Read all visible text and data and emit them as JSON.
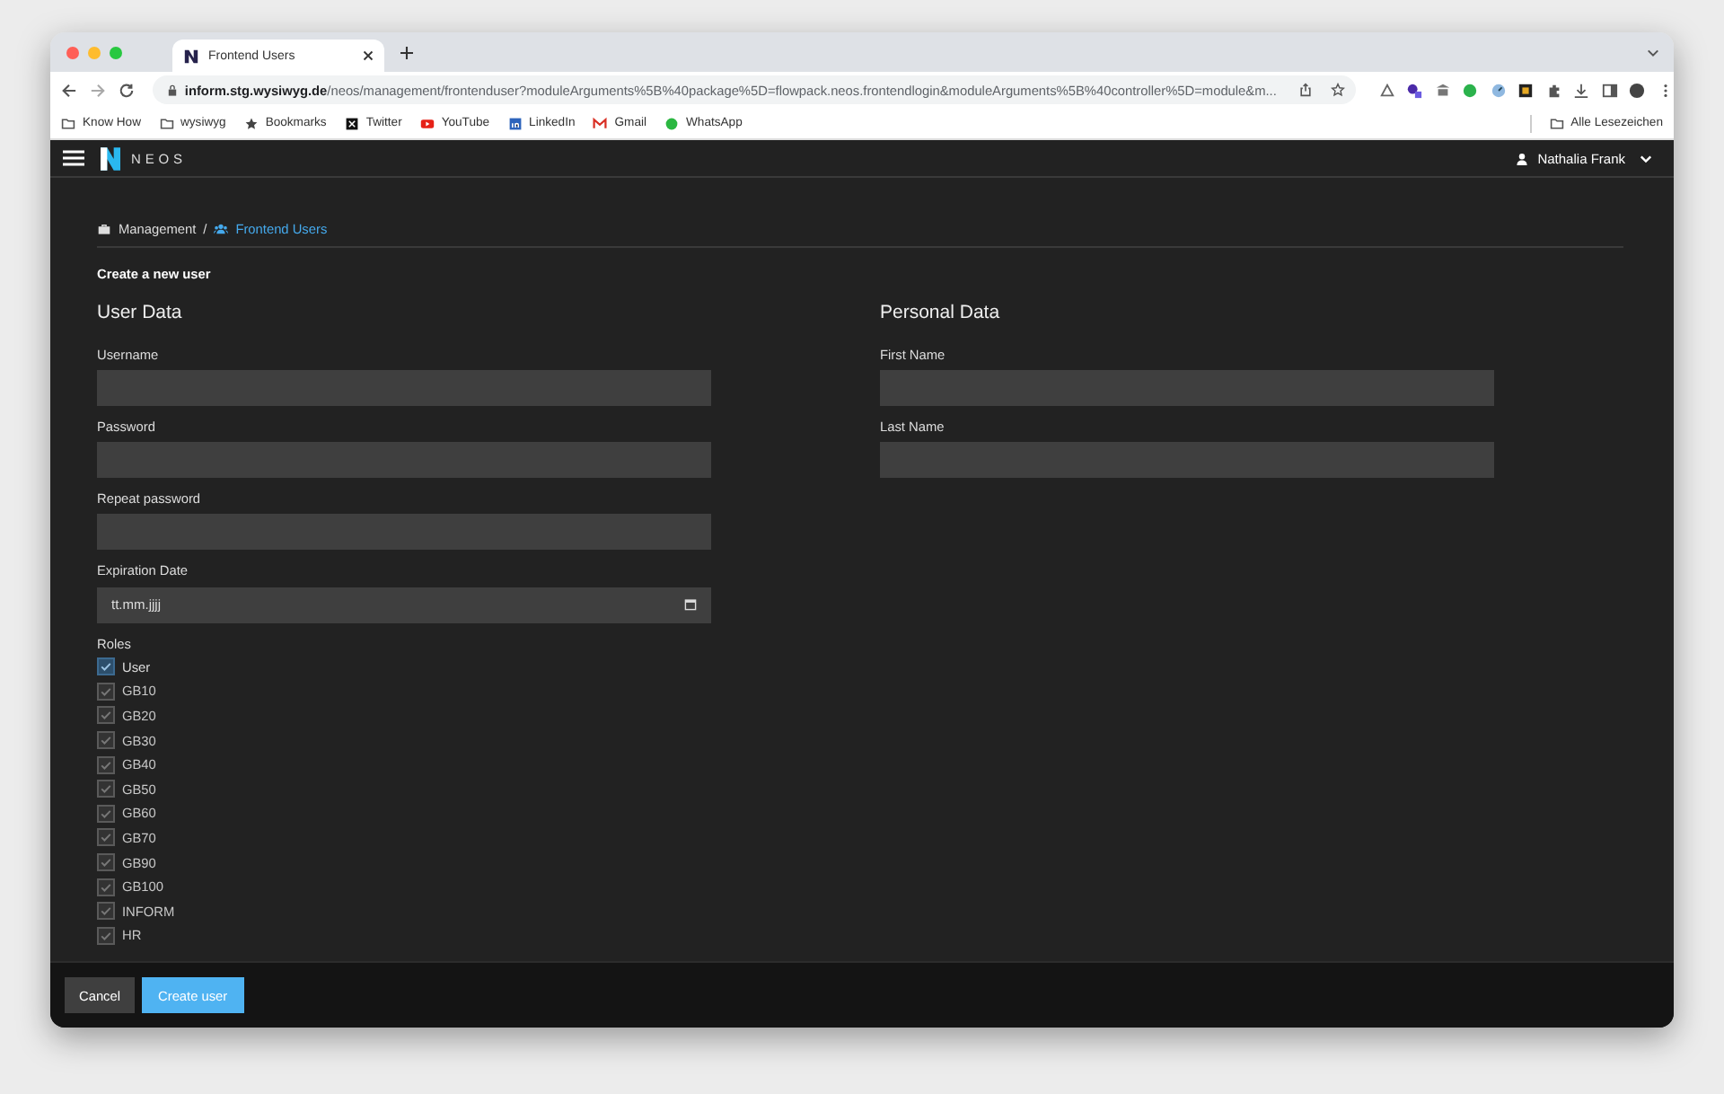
{
  "browser": {
    "tab_title": "Frontend Users",
    "url_host": "inform.stg.wysiwyg.de",
    "url_path": "/neos/management/frontenduser?moduleArguments%5B%40package%5D=flowpack.neos.frontendlogin&moduleArguments%5B%40controller%5D=module&m...",
    "bookmarks": [
      {
        "label": "Know How",
        "kind": "folder"
      },
      {
        "label": "wysiwyg",
        "kind": "folder"
      },
      {
        "label": "Bookmarks",
        "kind": "star"
      },
      {
        "label": "Twitter",
        "kind": "x"
      },
      {
        "label": "YouTube",
        "kind": "youtube"
      },
      {
        "label": "LinkedIn",
        "kind": "linkedin"
      },
      {
        "label": "Gmail",
        "kind": "gmail"
      },
      {
        "label": "WhatsApp",
        "kind": "whatsapp"
      }
    ],
    "other_bookmarks": "Alle Lesezeichen"
  },
  "header": {
    "logo_text": "NEOS",
    "user": "Nathalia Frank"
  },
  "breadcrumb": {
    "separator": "/",
    "items": [
      {
        "label": "Management",
        "kind": "briefcase",
        "selected": false
      },
      {
        "label": "Frontend Users",
        "kind": "users",
        "selected": true
      }
    ]
  },
  "form_title": "Create a new user",
  "user_data": {
    "heading": "User Data",
    "fields": [
      {
        "label": "Username",
        "kind": "text"
      },
      {
        "label": "Password",
        "kind": "password"
      },
      {
        "label": "Repeat password",
        "kind": "password"
      },
      {
        "label": "Expiration Date",
        "kind": "date",
        "placeholder": "tt.mm.jjjj"
      }
    ]
  },
  "roles": {
    "label": "Roles",
    "items": [
      {
        "label": "User",
        "checked": true,
        "disabled": false
      },
      {
        "label": "GB10",
        "checked": true,
        "disabled": true
      },
      {
        "label": "GB20",
        "checked": true,
        "disabled": true
      },
      {
        "label": "GB30",
        "checked": true,
        "disabled": true
      },
      {
        "label": "GB40",
        "checked": true,
        "disabled": true
      },
      {
        "label": "GB50",
        "checked": true,
        "disabled": true
      },
      {
        "label": "GB60",
        "checked": true,
        "disabled": true
      },
      {
        "label": "GB70",
        "checked": true,
        "disabled": true
      },
      {
        "label": "GB90",
        "checked": true,
        "disabled": true
      },
      {
        "label": "GB100",
        "checked": true,
        "disabled": true
      },
      {
        "label": "INFORM",
        "checked": true,
        "disabled": true
      },
      {
        "label": "HR",
        "checked": true,
        "disabled": true
      }
    ]
  },
  "personal_data": {
    "heading": "Personal Data",
    "fields": [
      {
        "label": "First Name",
        "kind": "text"
      },
      {
        "label": "Last Name",
        "kind": "text"
      }
    ]
  },
  "buttons": [
    {
      "label": "Cancel",
      "kind": "secondary"
    },
    {
      "label": "Create user",
      "kind": "primary"
    }
  ]
}
